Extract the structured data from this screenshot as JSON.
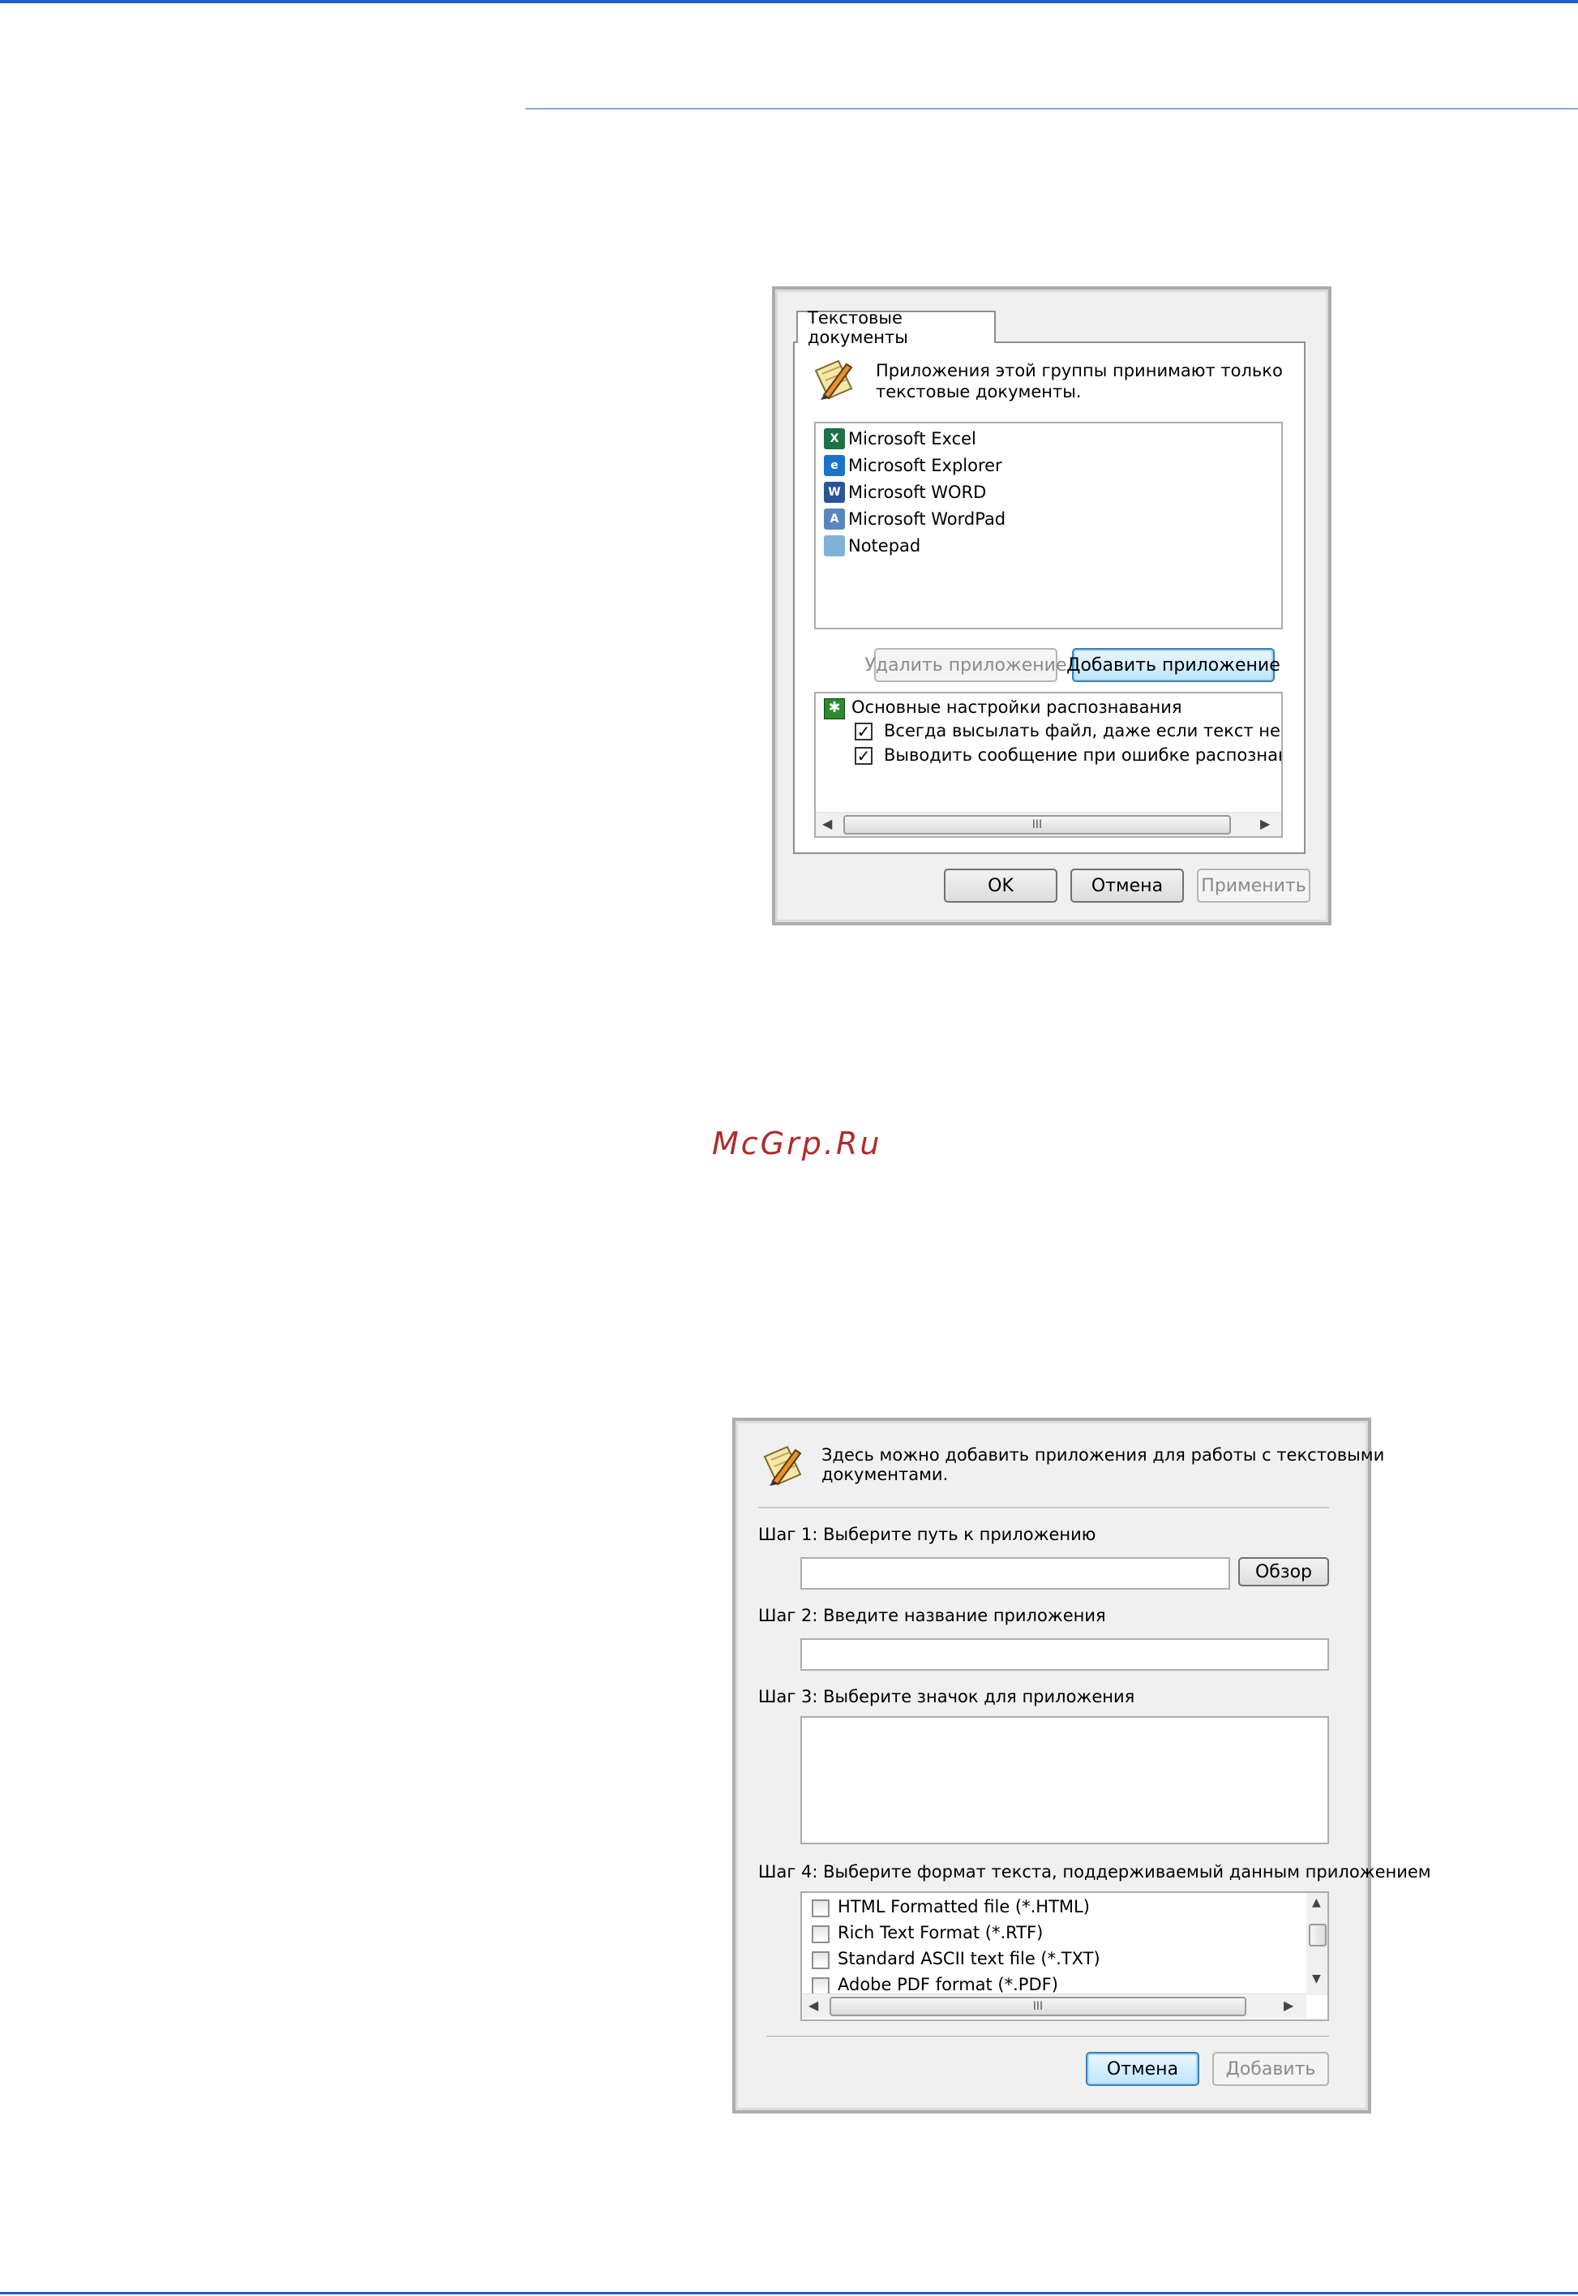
{
  "watermark": "McGrp.Ru",
  "dialog1": {
    "tab_label": "Текстовые документы",
    "info_text": [
      "Приложения этой группы принимают только",
      "текстовые документы."
    ],
    "apps": [
      {
        "name": "Microsoft Excel",
        "icon": "excel-icon",
        "color": "#1e7145",
        "glyph": "X"
      },
      {
        "name": "Microsoft Explorer",
        "icon": "ie-icon",
        "color": "#1a73c8",
        "glyph": "e"
      },
      {
        "name": "Microsoft WORD",
        "icon": "word-icon",
        "color": "#2a5699",
        "glyph": "W"
      },
      {
        "name": "Microsoft WordPad",
        "icon": "wordpad-icon",
        "color": "#5a86c0",
        "glyph": "A"
      },
      {
        "name": "Notepad",
        "icon": "notepad-icon",
        "color": "#7fb2d9",
        "glyph": ""
      }
    ],
    "remove_button": "Удалить приложение",
    "add_button": "Добавить приложение",
    "settings_title": "Основные настройки распознавания",
    "options": [
      {
        "label": "Всегда высылать файл, даже если текст не найд",
        "checked": true
      },
      {
        "label": "Выводить сообщение при ошибке распознавания",
        "checked": true
      }
    ],
    "ok_button": "OK",
    "cancel_button": "Отмена",
    "apply_button": "Применить"
  },
  "dialog2": {
    "info_text": [
      "Здесь можно добавить приложения для работы с текстовыми",
      "документами."
    ],
    "step1_label": "Шаг 1: Выберите путь к приложению",
    "browse_button": "Обзор",
    "step2_label": "Шаг 2: Введите название приложения",
    "step3_label": "Шаг 3: Выберите значок для приложения",
    "step4_label": "Шаг 4: Выберите формат текста, поддерживаемый данным приложением",
    "formats": [
      {
        "label": "HTML Formatted file (*.HTML)",
        "checked": false
      },
      {
        "label": "Rich Text Format (*.RTF)",
        "checked": false
      },
      {
        "label": "Standard ASCII text file (*.TXT)",
        "checked": false
      },
      {
        "label": "Adobe PDF format (*.PDF)",
        "checked": false
      }
    ],
    "cancel_button": "Отмена",
    "add_button": "Добавить"
  },
  "scrollbar_grip": "III"
}
